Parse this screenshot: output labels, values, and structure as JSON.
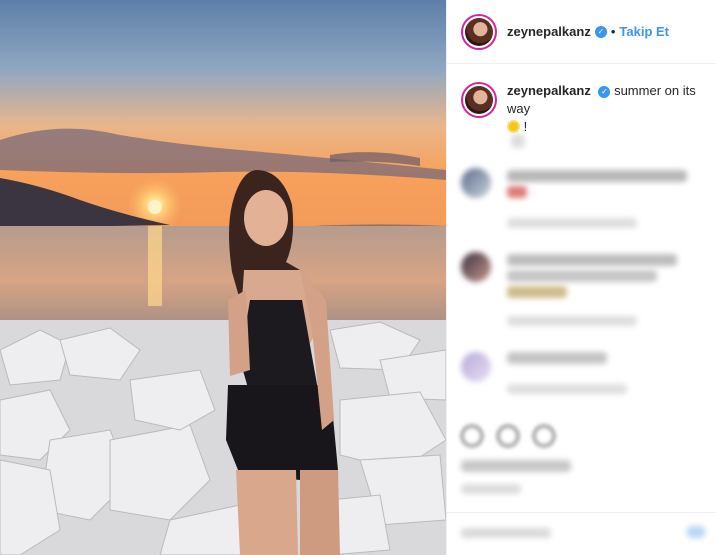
{
  "post": {
    "username": "zeynepalkanz",
    "separator": "•",
    "follow_label": "Takip Et",
    "caption": "summer on its way",
    "caption_tail": "!"
  },
  "icons": {
    "verified": "verified-badge-icon",
    "sun_emoji": "sun-emoji-icon"
  },
  "colors": {
    "link": "#3897f0",
    "story_ring": "#d6249f"
  }
}
